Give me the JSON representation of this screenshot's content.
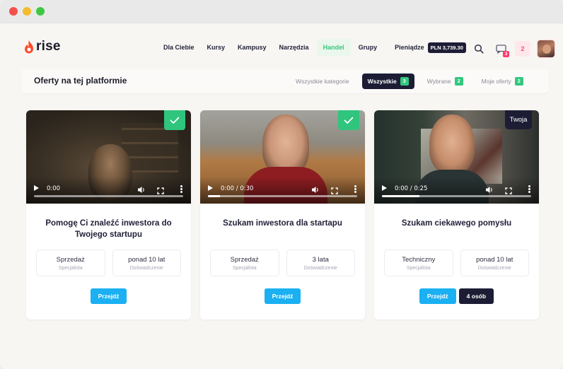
{
  "app": {
    "logo_text": "rise",
    "brand_color": "#ff4b2b",
    "accent_green": "#2fc57d",
    "accent_blue": "#1ab0f2",
    "dark": "#1c1d35"
  },
  "nav": {
    "items": [
      {
        "label": "Dla Ciebie",
        "active": false
      },
      {
        "label": "Kursy",
        "active": false
      },
      {
        "label": "Kampusy",
        "active": false
      },
      {
        "label": "Narzędzia",
        "active": false
      },
      {
        "label": "Handel",
        "active": true
      },
      {
        "label": "Grupy",
        "active": false
      }
    ],
    "wallet_label": "Pieniądze",
    "wallet_amount": "PLN 3,739.30",
    "icons": [
      "search-icon",
      "chat-icon"
    ],
    "messages_count": "3",
    "notifications_count": "2"
  },
  "filter": {
    "title": "Oferty na tej platformie",
    "category_label": "Wszystkie kategorie",
    "tabs": [
      {
        "label": "Wszystkie",
        "count": "3",
        "active": true
      },
      {
        "label": "Wybrane",
        "count": "2",
        "active": false
      },
      {
        "label": "Moje oferty",
        "count": "2",
        "active": false
      }
    ]
  },
  "offers": [
    {
      "title": "Pomogę Ci znaleźć inwestora do Twojego startupu",
      "badge": "check",
      "video_time": "0:00",
      "video_progress": 0,
      "stats": [
        {
          "value": "Sprzedaż",
          "label": "Specjalista"
        },
        {
          "value": "ponad 10 lat",
          "label": "Doświadczenie"
        }
      ],
      "button": "Przejdź"
    },
    {
      "title": "Szukam inwestora dla startapu",
      "badge": "check",
      "video_time": "0:00 / 0:30",
      "video_progress": 0.08,
      "stats": [
        {
          "value": "Sprzedaż",
          "label": "Specjalista"
        },
        {
          "value": "3 lata",
          "label": "Doświadczenie"
        }
      ],
      "button": "Przejdź"
    },
    {
      "title": "Szukam ciekawego pomysłu",
      "badge": "Twoja",
      "video_time": "0:00 / 0:25",
      "video_progress": 0.25,
      "stats": [
        {
          "value": "Techniczny",
          "label": "Specjalista"
        },
        {
          "value": "ponad 10 lat",
          "label": "Doświadczenie"
        }
      ],
      "button": "Przejdź",
      "people_button": "4 osób"
    }
  ]
}
